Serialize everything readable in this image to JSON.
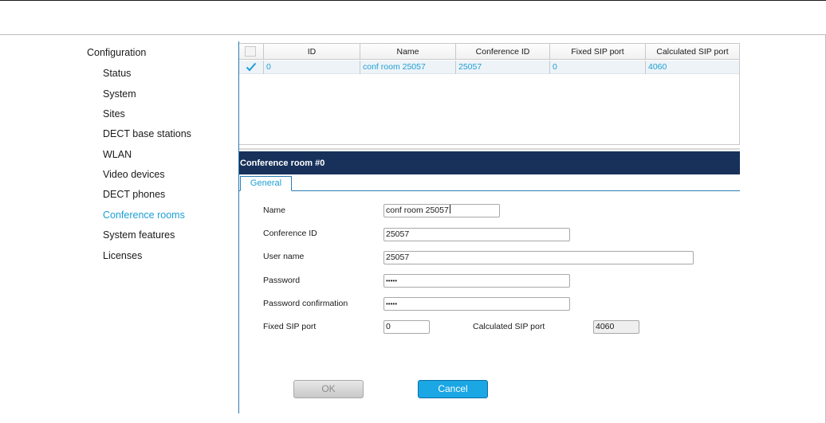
{
  "sidebar": {
    "root_label": "Configuration",
    "items": [
      {
        "label": "Status",
        "active": false
      },
      {
        "label": "System",
        "active": false
      },
      {
        "label": "Sites",
        "active": false
      },
      {
        "label": "DECT base stations",
        "active": false
      },
      {
        "label": "WLAN",
        "active": false
      },
      {
        "label": "Video devices",
        "active": false
      },
      {
        "label": "DECT phones",
        "active": false
      },
      {
        "label": "Conference rooms",
        "active": true
      },
      {
        "label": "System features",
        "active": false
      },
      {
        "label": "Licenses",
        "active": false
      }
    ]
  },
  "table": {
    "columns": [
      "ID",
      "Name",
      "Conference ID",
      "Fixed SIP port",
      "Calculated SIP port"
    ],
    "rows": [
      {
        "selected": true,
        "cells": [
          "0",
          "conf room 25057",
          "25057",
          "0",
          "4060"
        ]
      }
    ]
  },
  "panel": {
    "title": "Conference room #0",
    "tab_label": "General",
    "fields": {
      "name": {
        "label": "Name",
        "value": "conf room 25057"
      },
      "conference_id": {
        "label": "Conference ID",
        "value": "25057"
      },
      "user_name": {
        "label": "User name",
        "value": "25057"
      },
      "password": {
        "label": "Password",
        "value": "•••••"
      },
      "password_confirmation": {
        "label": "Password confirmation",
        "value": "•••••"
      },
      "fixed_sip_port": {
        "label": "Fixed SIP port",
        "value": "0"
      },
      "calculated_sip_port": {
        "label": "Calculated SIP port",
        "value": "4060"
      }
    },
    "ok_label": "OK",
    "cancel_label": "Cancel"
  },
  "colors": {
    "accent": "#1c9fd5",
    "header_bg": "#17315a",
    "cancel_bg": "#1ba6e4",
    "selected_row_bg": "#eef3f8"
  }
}
